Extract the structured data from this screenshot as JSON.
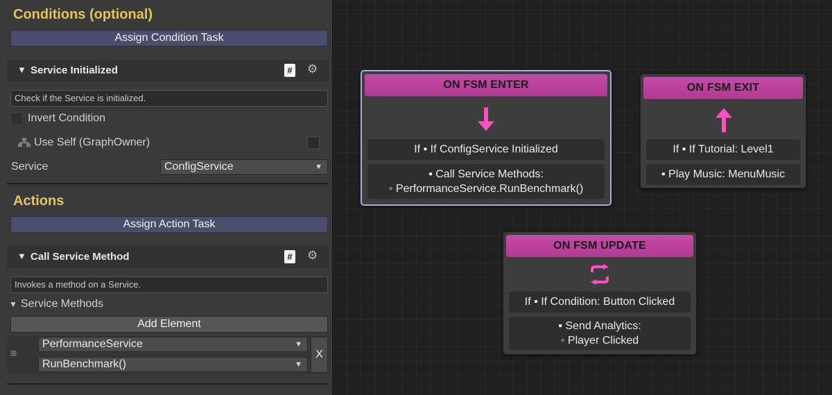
{
  "inspector": {
    "conditions": {
      "title": "Conditions (optional)",
      "assign_label": "Assign Condition Task",
      "task": {
        "name": "Service Initialized",
        "description": "Check if the Service is initialized.",
        "invert_label": "Invert Condition",
        "use_self_label": "Use Self (GraphOwner)",
        "service_label": "Service",
        "service_value": "ConfigService"
      }
    },
    "actions": {
      "title": "Actions",
      "assign_label": "Assign Action Task",
      "task": {
        "name": "Call Service Method",
        "description": "Invokes a method on a Service.",
        "methods_label": "Service Methods",
        "add_element_label": "Add Element",
        "element": {
          "service_value": "PerformanceService",
          "method_value": "RunBenchmark()",
          "remove_label": "X"
        }
      }
    }
  },
  "nodes": {
    "enter": {
      "title": "ON FSM ENTER",
      "condition": "If  ▪ If ConfigService Initialized",
      "action_line1": "▪ Call Service Methods:",
      "action_line2": "◦ PerformanceService.RunBenchmark()"
    },
    "exit": {
      "title": "ON FSM EXIT",
      "condition": "If  ▪ If Tutorial: Level1",
      "action_line1": "▪ Play Music: MenuMusic"
    },
    "update": {
      "title": "ON FSM UPDATE",
      "condition": "If  ▪ If Condition: Button Clicked",
      "action_line1": "▪ Send Analytics:",
      "action_line2": "◦ Player Clicked"
    }
  },
  "colors": {
    "accent_title": "#e2c55c",
    "node_header": "#b03a92",
    "node_icon": "#ff4fc4",
    "selection_outline": "#a8acd8"
  },
  "icons": [
    "arrow-down-icon",
    "arrow-up-icon",
    "loop-icon",
    "gear-icon",
    "script-hash-icon",
    "hierarchy-icon",
    "triangle-down-icon",
    "reorder-handle-icon",
    "dropdown-arrow-icon"
  ]
}
